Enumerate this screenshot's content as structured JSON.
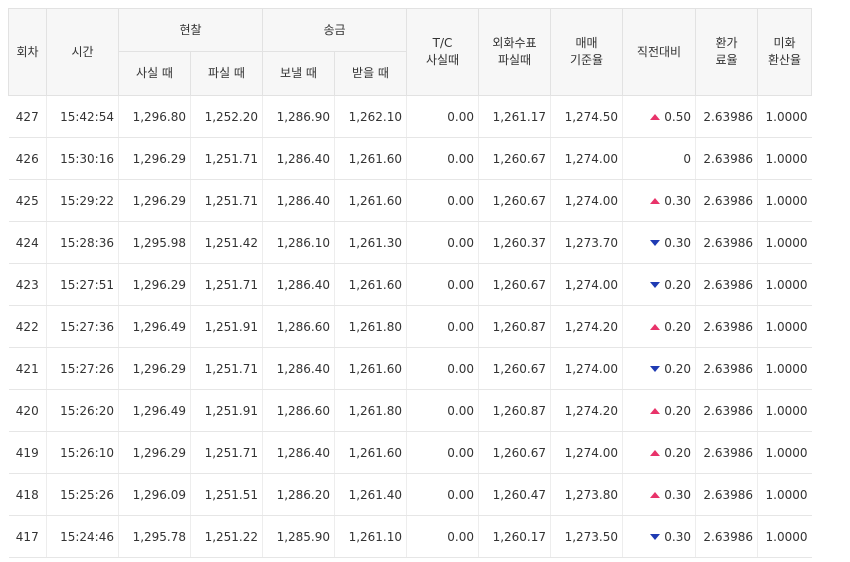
{
  "headers": {
    "round": "회차",
    "time": "시간",
    "cash": "현찰",
    "cash_buy": "사실 때",
    "cash_sell": "파실 때",
    "remit": "송금",
    "remit_send": "보낼 때",
    "remit_receive": "받을 때",
    "tc_line1": "T/C",
    "tc_line2": "사실때",
    "check_line1": "외화수표",
    "check_line2": "파실때",
    "base_line1": "매매",
    "base_line2": "기준율",
    "change": "직전대비",
    "fx_line1": "환가",
    "fx_line2": "료율",
    "usd_line1": "미화",
    "usd_line2": "환산율"
  },
  "colors": {
    "up": "#e8336a",
    "down": "#1f3bb3"
  },
  "rows": [
    {
      "round": "427",
      "time": "15:42:54",
      "cash_buy": "1,296.80",
      "cash_sell": "1,252.20",
      "send": "1,286.90",
      "receive": "1,262.10",
      "tc": "0.00",
      "check": "1,261.17",
      "base": "1,274.50",
      "dir": "up",
      "change": "0.50",
      "fx": "2.63986",
      "usd": "1.0000"
    },
    {
      "round": "426",
      "time": "15:30:16",
      "cash_buy": "1,296.29",
      "cash_sell": "1,251.71",
      "send": "1,286.40",
      "receive": "1,261.60",
      "tc": "0.00",
      "check": "1,260.67",
      "base": "1,274.00",
      "dir": "none",
      "change": "0",
      "fx": "2.63986",
      "usd": "1.0000"
    },
    {
      "round": "425",
      "time": "15:29:22",
      "cash_buy": "1,296.29",
      "cash_sell": "1,251.71",
      "send": "1,286.40",
      "receive": "1,261.60",
      "tc": "0.00",
      "check": "1,260.67",
      "base": "1,274.00",
      "dir": "up",
      "change": "0.30",
      "fx": "2.63986",
      "usd": "1.0000"
    },
    {
      "round": "424",
      "time": "15:28:36",
      "cash_buy": "1,295.98",
      "cash_sell": "1,251.42",
      "send": "1,286.10",
      "receive": "1,261.30",
      "tc": "0.00",
      "check": "1,260.37",
      "base": "1,273.70",
      "dir": "down",
      "change": "0.30",
      "fx": "2.63986",
      "usd": "1.0000"
    },
    {
      "round": "423",
      "time": "15:27:51",
      "cash_buy": "1,296.29",
      "cash_sell": "1,251.71",
      "send": "1,286.40",
      "receive": "1,261.60",
      "tc": "0.00",
      "check": "1,260.67",
      "base": "1,274.00",
      "dir": "down",
      "change": "0.20",
      "fx": "2.63986",
      "usd": "1.0000"
    },
    {
      "round": "422",
      "time": "15:27:36",
      "cash_buy": "1,296.49",
      "cash_sell": "1,251.91",
      "send": "1,286.60",
      "receive": "1,261.80",
      "tc": "0.00",
      "check": "1,260.87",
      "base": "1,274.20",
      "dir": "up",
      "change": "0.20",
      "fx": "2.63986",
      "usd": "1.0000"
    },
    {
      "round": "421",
      "time": "15:27:26",
      "cash_buy": "1,296.29",
      "cash_sell": "1,251.71",
      "send": "1,286.40",
      "receive": "1,261.60",
      "tc": "0.00",
      "check": "1,260.67",
      "base": "1,274.00",
      "dir": "down",
      "change": "0.20",
      "fx": "2.63986",
      "usd": "1.0000"
    },
    {
      "round": "420",
      "time": "15:26:20",
      "cash_buy": "1,296.49",
      "cash_sell": "1,251.91",
      "send": "1,286.60",
      "receive": "1,261.80",
      "tc": "0.00",
      "check": "1,260.87",
      "base": "1,274.20",
      "dir": "up",
      "change": "0.20",
      "fx": "2.63986",
      "usd": "1.0000"
    },
    {
      "round": "419",
      "time": "15:26:10",
      "cash_buy": "1,296.29",
      "cash_sell": "1,251.71",
      "send": "1,286.40",
      "receive": "1,261.60",
      "tc": "0.00",
      "check": "1,260.67",
      "base": "1,274.00",
      "dir": "up",
      "change": "0.20",
      "fx": "2.63986",
      "usd": "1.0000"
    },
    {
      "round": "418",
      "time": "15:25:26",
      "cash_buy": "1,296.09",
      "cash_sell": "1,251.51",
      "send": "1,286.20",
      "receive": "1,261.40",
      "tc": "0.00",
      "check": "1,260.47",
      "base": "1,273.80",
      "dir": "up",
      "change": "0.30",
      "fx": "2.63986",
      "usd": "1.0000"
    },
    {
      "round": "417",
      "time": "15:24:46",
      "cash_buy": "1,295.78",
      "cash_sell": "1,251.22",
      "send": "1,285.90",
      "receive": "1,261.10",
      "tc": "0.00",
      "check": "1,260.17",
      "base": "1,273.50",
      "dir": "down",
      "change": "0.30",
      "fx": "2.63986",
      "usd": "1.0000"
    }
  ]
}
